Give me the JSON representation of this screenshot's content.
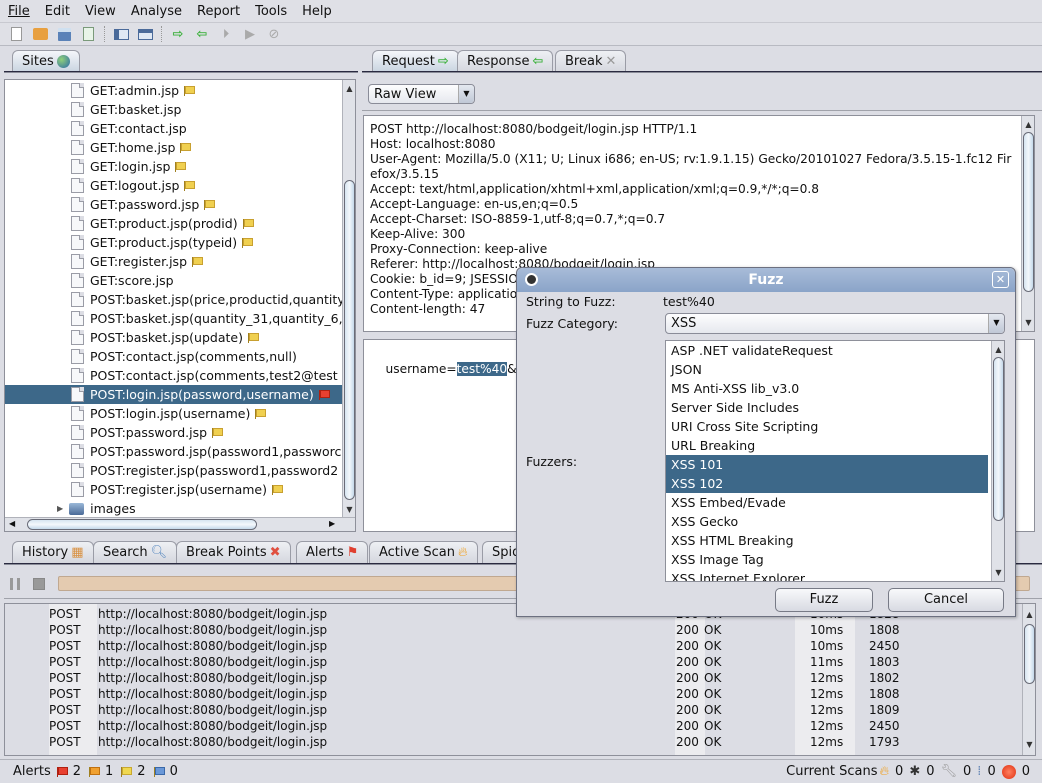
{
  "menu": [
    "File",
    "Edit",
    "View",
    "Analyse",
    "Report",
    "Tools",
    "Help"
  ],
  "toolbar": {
    "icons": [
      "new-session-icon",
      "open-session-icon",
      "save-session-icon",
      "properties-icon",
      "layout-split-icon",
      "layout-full-icon",
      "forward-arrow-icon",
      "back-arrow-icon",
      "step-icon",
      "continue-icon",
      "stop-icon"
    ]
  },
  "sites": {
    "tab_label": "Sites",
    "items": [
      {
        "label": "GET:admin.jsp",
        "flag": "yellow"
      },
      {
        "label": "GET:basket.jsp",
        "flag": ""
      },
      {
        "label": "GET:contact.jsp",
        "flag": ""
      },
      {
        "label": "GET:home.jsp",
        "flag": "yellow"
      },
      {
        "label": "GET:login.jsp",
        "flag": "yellow"
      },
      {
        "label": "GET:logout.jsp",
        "flag": "yellow"
      },
      {
        "label": "GET:password.jsp",
        "flag": "yellow"
      },
      {
        "label": "GET:product.jsp(prodid)",
        "flag": "yellow"
      },
      {
        "label": "GET:product.jsp(typeid)",
        "flag": "yellow"
      },
      {
        "label": "GET:register.jsp",
        "flag": "yellow"
      },
      {
        "label": "GET:score.jsp",
        "flag": ""
      },
      {
        "label": "POST:basket.jsp(price,productid,quantity",
        "flag": ""
      },
      {
        "label": "POST:basket.jsp(quantity_31,quantity_6,",
        "flag": ""
      },
      {
        "label": "POST:basket.jsp(update)",
        "flag": "yellow"
      },
      {
        "label": "POST:contact.jsp(comments,null)",
        "flag": ""
      },
      {
        "label": "POST:contact.jsp(comments,test2@test",
        "flag": ""
      },
      {
        "label": "POST:login.jsp(password,username)",
        "flag": "red",
        "selected": true
      },
      {
        "label": "POST:login.jsp(username)",
        "flag": "yellow"
      },
      {
        "label": "POST:password.jsp",
        "flag": "yellow"
      },
      {
        "label": "POST:password.jsp(password1,passworc",
        "flag": ""
      },
      {
        "label": "POST:register.jsp(password1,password2",
        "flag": ""
      },
      {
        "label": "POST:register.jsp(username)",
        "flag": "yellow"
      }
    ],
    "folder": "images"
  },
  "request_tabs": [
    {
      "label": "Request",
      "icon": "forward-arrow-icon"
    },
    {
      "label": "Response",
      "icon": "back-arrow-icon"
    },
    {
      "label": "Break",
      "icon": "close-x-icon"
    }
  ],
  "view_select": "Raw View",
  "request_header_lines": [
    "POST http://localhost:8080/bodgeit/login.jsp HTTP/1.1",
    "Host: localhost:8080",
    "User-Agent: Mozilla/5.0 (X11; U; Linux i686; en-US; rv:1.9.1.15) Gecko/20101027 Fedora/3.5.15-1.fc12 Fir",
    "efox/3.5.15",
    "Accept: text/html,application/xhtml+xml,application/xml;q=0.9,*/*;q=0.8",
    "Accept-Language: en-us,en;q=0.5",
    "Accept-Charset: ISO-8859-1,utf-8;q=0.7,*;q=0.7",
    "Keep-Alive: 300",
    "Proxy-Connection: keep-alive",
    "Referer: http://localhost:8080/bodgeit/login.jsp",
    "Cookie: b_id=9; JSESSION",
    "Content-Type: application",
    "Content-length: 47"
  ],
  "request_body": {
    "before": "username=",
    "selected": "test%40",
    "after": "&pass"
  },
  "fuzz_dialog": {
    "title": "Fuzz",
    "string_label": "String to Fuzz:",
    "string_value": "test%40",
    "category_label": "Fuzz Category:",
    "category_value": "XSS",
    "fuzzers_label": "Fuzzers:",
    "fuzzers": [
      {
        "label": "ASP .NET validateRequest"
      },
      {
        "label": "JSON"
      },
      {
        "label": "MS Anti-XSS lib_v3.0"
      },
      {
        "label": "Server Side Includes"
      },
      {
        "label": "URI Cross Site Scripting"
      },
      {
        "label": "URL Breaking"
      },
      {
        "label": "XSS 101",
        "selected": true
      },
      {
        "label": "XSS 102",
        "selected": true
      },
      {
        "label": "XSS Embed/Evade"
      },
      {
        "label": "XSS Gecko"
      },
      {
        "label": "XSS HTML Breaking"
      },
      {
        "label": "XSS Image Tag"
      },
      {
        "label": "XSS Internet Explorer"
      }
    ],
    "fuzz_button": "Fuzz",
    "cancel_button": "Cancel"
  },
  "bottom_tabs": [
    {
      "label": "History",
      "icon": "calendar-icon"
    },
    {
      "label": "Search",
      "icon": "magnifier-icon"
    },
    {
      "label": "Break Points",
      "icon": "red-x-icon"
    },
    {
      "label": "Alerts",
      "icon": "red-flag-icon"
    },
    {
      "label": "Active Scan",
      "icon": "flame-icon"
    },
    {
      "label": "Spid",
      "icon": ""
    }
  ],
  "results": [
    {
      "method": "POST",
      "url": "http://localhost:8080/bodgeit/login.jsp",
      "code": "200",
      "reason": "OK",
      "time": "10ms",
      "size": "1828"
    },
    {
      "method": "POST",
      "url": "http://localhost:8080/bodgeit/login.jsp",
      "code": "200",
      "reason": "OK",
      "time": "10ms",
      "size": "1808"
    },
    {
      "method": "POST",
      "url": "http://localhost:8080/bodgeit/login.jsp",
      "code": "200",
      "reason": "OK",
      "time": "10ms",
      "size": "2450"
    },
    {
      "method": "POST",
      "url": "http://localhost:8080/bodgeit/login.jsp",
      "code": "200",
      "reason": "OK",
      "time": "11ms",
      "size": "1803"
    },
    {
      "method": "POST",
      "url": "http://localhost:8080/bodgeit/login.jsp",
      "code": "200",
      "reason": "OK",
      "time": "12ms",
      "size": "1802"
    },
    {
      "method": "POST",
      "url": "http://localhost:8080/bodgeit/login.jsp",
      "code": "200",
      "reason": "OK",
      "time": "12ms",
      "size": "1808"
    },
    {
      "method": "POST",
      "url": "http://localhost:8080/bodgeit/login.jsp",
      "code": "200",
      "reason": "OK",
      "time": "12ms",
      "size": "1809"
    },
    {
      "method": "POST",
      "url": "http://localhost:8080/bodgeit/login.jsp",
      "code": "200",
      "reason": "OK",
      "time": "12ms",
      "size": "2450"
    },
    {
      "method": "POST",
      "url": "http://localhost:8080/bodgeit/login.jsp",
      "code": "200",
      "reason": "OK",
      "time": "12ms",
      "size": "1793"
    }
  ],
  "status": {
    "alerts_label": "Alerts",
    "alerts": [
      {
        "color": "red",
        "count": "2"
      },
      {
        "color": "orange",
        "count": "1"
      },
      {
        "color": "yellow",
        "count": "2"
      },
      {
        "color": "blue",
        "count": "0"
      }
    ],
    "scans_label": "Current Scans",
    "scans": [
      {
        "icon": "flame-icon",
        "count": "0"
      },
      {
        "icon": "spider-icon",
        "count": "0"
      },
      {
        "icon": "wrench-icon",
        "count": "0"
      },
      {
        "icon": "list-icon",
        "count": "0"
      },
      {
        "icon": "red-burst-icon",
        "count": "0"
      }
    ]
  },
  "colors": {
    "selection": "#3d6889",
    "progress": "#e4cbb0"
  }
}
